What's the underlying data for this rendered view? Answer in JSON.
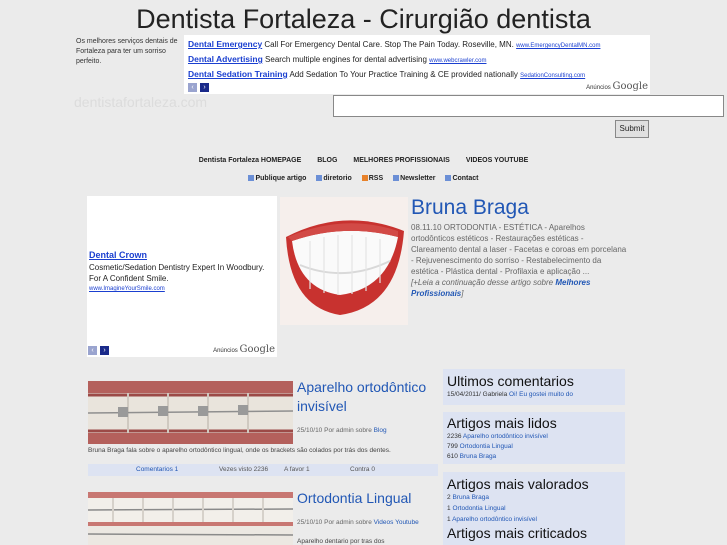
{
  "site": {
    "title": "Dentista Fortaleza - Cirurgião dentista",
    "tagline": "Os melhores serviços dentais de Fortaleza para ter um sorriso perfeito.",
    "watermark": "dentistafortaleza.com"
  },
  "top_ads": {
    "items": [
      {
        "title": "Dental Emergency",
        "text": "Call For Emergency Dental Care. Stop The Pain Today. Roseville, MN.",
        "url": "www.EmergencyDentalMN.com"
      },
      {
        "title": "Dental Advertising",
        "text": "Search multiple engines for dental advertising",
        "url": "www.webcrawler.com"
      },
      {
        "title": "Dental Sedation Training",
        "text": "Add Sedation To Your Practice Training & CE provided nationally",
        "url": "SedationConsulting.com"
      }
    ],
    "prev": "‹",
    "next": "›",
    "adchoices_label": "Anúncios",
    "adchoices_brand": "Google"
  },
  "search": {
    "value": "",
    "submit_label": "Submit"
  },
  "main_nav": [
    "Dentista Fortaleza HOMEPAGE",
    "BLOG",
    "MELHORES PROFISSIONAIS",
    "VIDEOS YOUTUBE"
  ],
  "sub_nav": [
    {
      "label": "Publique artigo",
      "icon": "document-icon"
    },
    {
      "label": "diretorio",
      "icon": "folder-icon"
    },
    {
      "label": "RSS",
      "icon": "rss-icon"
    },
    {
      "label": "Newsletter",
      "icon": "mail-icon"
    },
    {
      "label": "Contact",
      "icon": "home-icon"
    }
  ],
  "left_ad": {
    "title": "Dental Crown",
    "text": "Cosmetic/Sedation Dentistry Expert In Woodbury. For A Confident Smile.",
    "url": "www.ImagineYourSmile.com",
    "adchoices_label": "Anúncios",
    "adchoices_brand": "Google"
  },
  "featured": {
    "title": "Bruna Braga",
    "date": "08.11.10",
    "body": "ORTODONTIA - ESTÉTICA - Aparelhos ortodônticos estéticos - Restaurações estéticas - Clareamento dental a laser - Facetas e coroas em porcelana - Rejuvenescimento do sorriso - Restabelecimento da estética - Plástica dental - Profilaxia e aplicação ...",
    "more_prefix": "[+Leia a continuação desse artigo sobre ",
    "more_link": "Melhores Profissionais",
    "more_suffix": "]"
  },
  "posts": [
    {
      "title": "Aparelho ortodôntico invisível",
      "date": "25/10/10",
      "by": "Por admin sobre",
      "category": "Blog",
      "excerpt": "Bruna Braga fala sobre o aparelho ortodôntico lingual, onde os brackets são colados por trás dos dentes.",
      "comments": "Comentarios 1",
      "views": "Vezes visto 2236",
      "favor": "A favor 1",
      "contra": "Contra 0"
    },
    {
      "title": "Ortodontia Lingual",
      "date": "25/10/10",
      "by": "Por admin sobre",
      "category": "Videos Youtube",
      "excerpt": "Aparelho dentario por tras dos"
    }
  ],
  "sidebar": {
    "ultimos": {
      "title": "Ultimos comentarios",
      "items": [
        {
          "meta": "15/04/2011/ Gabriela",
          "link": "Oi! Eu gostei muito do"
        }
      ]
    },
    "lidos": {
      "title": "Artigos mais lidos",
      "items": [
        {
          "count": "2236",
          "link": "Aparelho ortodôntico invisível"
        },
        {
          "count": "799",
          "link": "Ortodontia Lingual"
        },
        {
          "count": "610",
          "link": "Bruna Braga"
        }
      ]
    },
    "valorados": {
      "title": "Artigos mais valorados",
      "items": [
        {
          "count": "2",
          "link": "Bruna Braga"
        },
        {
          "count": "1",
          "link": "Ortodontia Lingual"
        },
        {
          "count": "1",
          "link": "Aparelho ortodôntico invisível"
        }
      ]
    },
    "criticados": {
      "title": "Artigos mais criticados"
    }
  },
  "colors": {
    "link": "#2157b5",
    "ad_link": "#1a3fd0",
    "widget_bg": "#dde3f2",
    "page_bg": "#ebebeb"
  }
}
